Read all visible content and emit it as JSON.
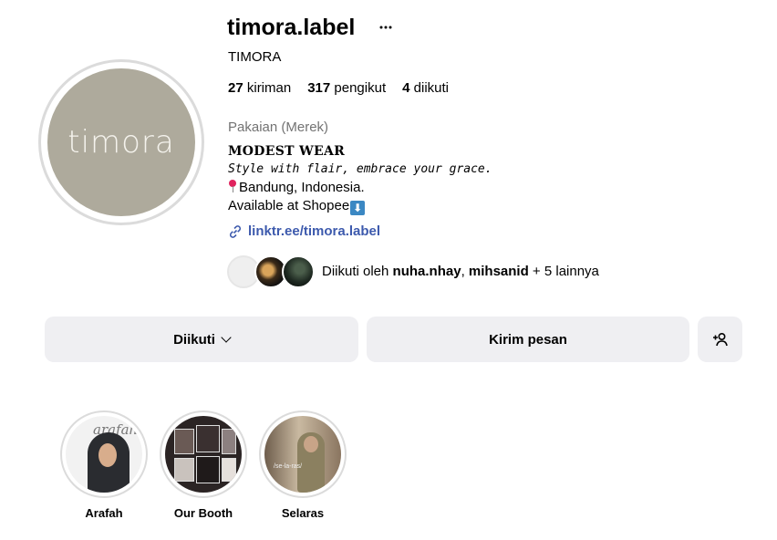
{
  "profile": {
    "avatar_text": "timora",
    "username": "timora.label",
    "more_icon": "more-horizontal-icon",
    "full_name": "TIMORA",
    "stats": {
      "posts_count": "27",
      "posts_label": "kiriman",
      "followers_count": "317",
      "followers_label": "pengikut",
      "following_count": "4",
      "following_label": "diikuti"
    },
    "category": "Pakaian (Merek)",
    "bio": {
      "line1": "MODEST WEAR",
      "line2": "Style with flair, embrace your grace.",
      "line3": "Bandung, Indonesia.",
      "line4": "Available at Shopee"
    },
    "link": "linktr.ee/timora.label",
    "followed_by": {
      "prefix": "Diikuti oleh ",
      "user1": "nuha.nhay",
      "sep": ", ",
      "user2": "mihsanid",
      "suffix": " + 5 lainnya"
    }
  },
  "actions": {
    "following_label": "Diikuti",
    "message_label": "Kirim pesan",
    "add_user_icon": "add-person-icon"
  },
  "highlights": [
    {
      "label": "Arafah",
      "image_text": "arafah"
    },
    {
      "label": "Our Booth"
    },
    {
      "label": "Selaras",
      "image_text": "/se-la-ras/"
    }
  ],
  "colors": {
    "avatar_bg": "#aeaa9c",
    "button_bg": "#efeff2",
    "link": "#3d5aad",
    "muted": "#737373"
  }
}
